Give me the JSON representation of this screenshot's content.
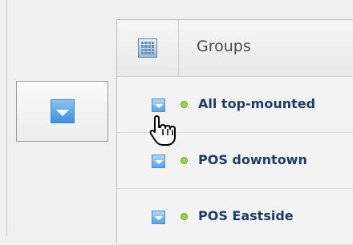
{
  "header": {
    "title": "Groups",
    "grid_icon": "grid-icon"
  },
  "toggle_button": {
    "icon": "dropdown-arrow-icon"
  },
  "groups": [
    {
      "label": "All top-mounted",
      "status_color": "#9bd04a",
      "icon": "dropdown-arrow-icon"
    },
    {
      "label": "POS downtown",
      "status_color": "#9bd04a",
      "icon": "dropdown-arrow-icon"
    },
    {
      "label": "POS Eastside",
      "status_color": "#9bd04a",
      "icon": "dropdown-arrow-icon"
    }
  ],
  "colors": {
    "accent_blue": "#3d8fdd",
    "label_text": "#1f3c67",
    "status_green": "#9bd04a"
  },
  "cursor": "hand-pointer-icon"
}
